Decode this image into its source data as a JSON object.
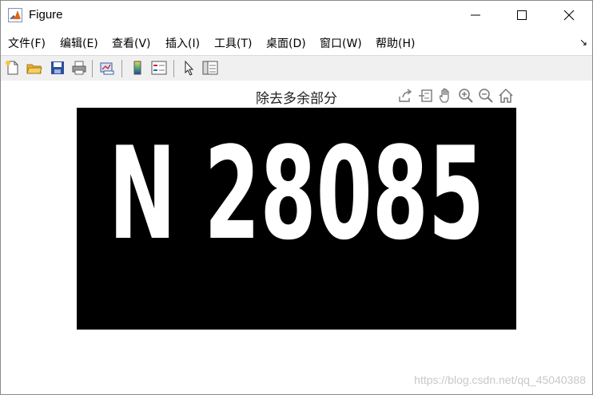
{
  "window": {
    "title": "Figure"
  },
  "menu": [
    "文件(F)",
    "编辑(E)",
    "查看(V)",
    "插入(I)",
    "工具(T)",
    "桌面(D)",
    "窗口(W)",
    "帮助(H)"
  ],
  "axes": {
    "title": "除去多余部分"
  },
  "image": {
    "plate": "N 28085"
  },
  "watermark": "https://blog.csdn.net/qq_45040388",
  "colors": {
    "image_background": "#000000",
    "plate_text": "#ffffff",
    "window": "#ffffff",
    "toolbar": "#f0f0f0"
  },
  "toolbar_icons": [
    "new-figure-icon",
    "open-file-icon",
    "save-icon",
    "print-icon",
    "link-plot-icon",
    "colorbar-icon",
    "legend-icon",
    "edit-plot-icon",
    "property-inspector-icon"
  ],
  "axes_toolbar_icons": [
    "export-icon",
    "brush-icon",
    "pan-icon",
    "zoom-in-icon",
    "zoom-out-icon",
    "home-icon"
  ]
}
